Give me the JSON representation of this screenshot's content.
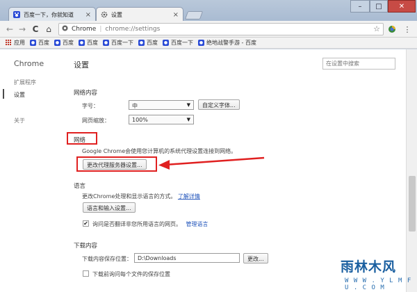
{
  "window": {
    "tabs": [
      {
        "title": "百度一下，你就知道",
        "close": "×"
      },
      {
        "title": "设置",
        "close": "×"
      }
    ],
    "controls": {
      "minimize": "–",
      "maximize": "□",
      "close": "✕"
    }
  },
  "toolbar": {
    "back": "←",
    "forward": "→",
    "reload": "C",
    "home": "⌂",
    "site_label": "Chrome",
    "separator": "|",
    "url": "chrome://settings",
    "star": "☆"
  },
  "bookmarks": [
    {
      "label": "应用",
      "icon": "apps-icon"
    },
    {
      "label": "百度",
      "icon": "paw-icon"
    },
    {
      "label": "百度",
      "icon": "paw-icon"
    },
    {
      "label": "百度",
      "icon": "paw-icon"
    },
    {
      "label": "百度一下",
      "icon": "paw-icon"
    },
    {
      "label": "百度",
      "icon": "paw-icon"
    },
    {
      "label": "百度一下",
      "icon": "paw-icon"
    },
    {
      "label": "绝地战警手游 - 百度",
      "icon": "paw-icon"
    }
  ],
  "sidebar": {
    "title": "Chrome",
    "items": [
      {
        "label": "扩展程序"
      },
      {
        "label": "设置"
      },
      {
        "label": "关于"
      }
    ]
  },
  "settings": {
    "title": "设置",
    "search_placeholder": "在设置中搜索",
    "web_content": {
      "title": "网络内容",
      "font_size_label": "字号：",
      "font_size_value": "中",
      "custom_fonts_button": "自定义字体...",
      "zoom_label": "网页缩放：",
      "zoom_value": "100%"
    },
    "network": {
      "title": "网络",
      "description": "Google Chrome会使用您计算机的系统代理设置连接到网络。",
      "proxy_button": "更改代理服务器设置..."
    },
    "language": {
      "title": "语言",
      "description": "更改Chrome处理和显示语言的方式。",
      "learn_more": "了解详情",
      "lang_input_button": "语言和输入设置...",
      "translate_checkbox_label": "询问是否翻译非您所用语言的网页。",
      "manage_languages": "管理语言",
      "translate_checked": true
    },
    "downloads": {
      "title": "下载内容",
      "location_label": "下载内容保存位置：",
      "location_value": "D:\\Downloads",
      "change_button": "更改...",
      "ask_checkbox_label": "下载前询问每个文件的保存位置",
      "ask_checked": false
    }
  },
  "watermark": {
    "text": "雨林木风",
    "url": "W W W . Y L M F U . C O M"
  },
  "colors": {
    "highlight": "#e02020",
    "link": "#2255bb"
  }
}
